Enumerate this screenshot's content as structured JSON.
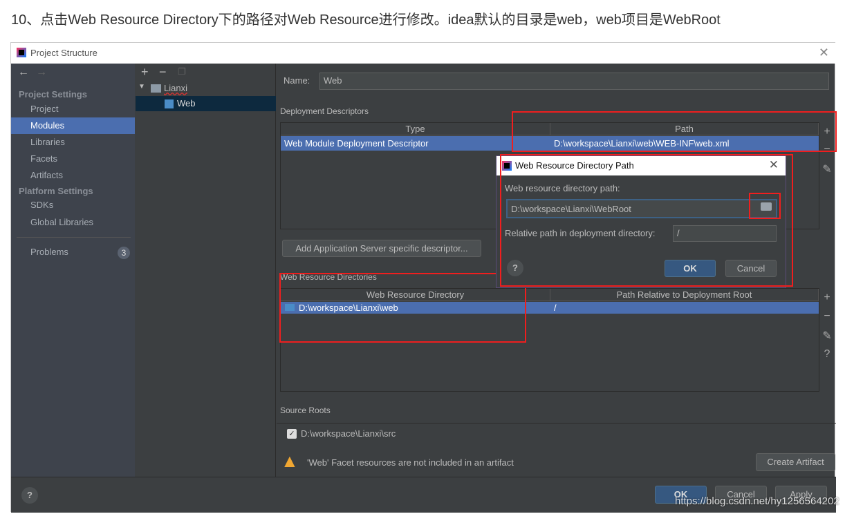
{
  "caption": "10、点击Web Resource Directory下的路径对Web Resource进行修改。idea默认的目录是web，web项目是WebRoot",
  "window": {
    "title": "Project Structure"
  },
  "sidebar": {
    "project_settings": "Project Settings",
    "items": [
      {
        "label": "Project"
      },
      {
        "label": "Modules"
      },
      {
        "label": "Libraries"
      },
      {
        "label": "Facets"
      },
      {
        "label": "Artifacts"
      }
    ],
    "platform_settings": "Platform Settings",
    "platform_items": [
      {
        "label": "SDKs"
      },
      {
        "label": "Global Libraries"
      }
    ],
    "problems": "Problems",
    "problems_count": "3"
  },
  "tree": {
    "root": "Lianxi",
    "child": "Web"
  },
  "main": {
    "name_label": "Name:",
    "name_value": "Web",
    "deployment_descriptors": "Deployment Descriptors",
    "dd_headers": [
      "Type",
      "Path"
    ],
    "dd_row": [
      "Web Module Deployment Descriptor",
      "D:\\workspace\\Lianxi\\web\\WEB-INF\\web.xml"
    ],
    "add_server_btn": "Add Application Server specific descriptor...",
    "web_resource_dirs": "Web Resource Directories",
    "wr_headers": [
      "Web Resource Directory",
      "Path Relative to Deployment Root"
    ],
    "wr_row": [
      "D:\\workspace\\Lianxi\\web",
      "/"
    ],
    "source_roots": "Source Roots",
    "source_root": "D:\\workspace\\Lianxi\\src",
    "warning": "'Web' Facet resources are not included in an artifact",
    "create_artifact": "Create Artifact"
  },
  "footer": {
    "ok": "OK",
    "cancel": "Cancel",
    "apply": "Apply"
  },
  "dialog": {
    "title": "Web Resource Directory Path",
    "path_label": "Web resource directory path:",
    "path_value": "D:\\workspace\\Lianxi\\WebRoot",
    "rel_label": "Relative path in deployment directory:",
    "rel_value": "/",
    "ok": "OK",
    "cancel": "Cancel"
  },
  "watermark": "https://blog.csdn.net/hy1256564202",
  "colors": {
    "selection": "#4b6eaf",
    "annotation": "#f01e1e",
    "warning": "#f0a732"
  }
}
